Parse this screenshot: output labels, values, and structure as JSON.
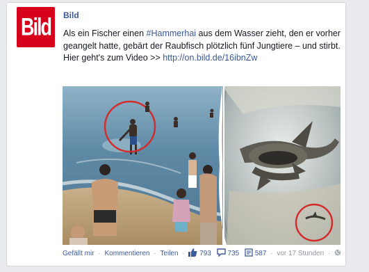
{
  "post": {
    "page_name": "Bild",
    "logo_text": "Bild",
    "text_line_pre": "Als ein Fischer einen ",
    "hashtag": "#Hammerhai",
    "text_line_post": " aus dem Wasser zieht, den er vorher geangelt hatte, gebärt der Raubfisch plötzlich fünf Jungtiere – und stirbt.",
    "video_line_pre": "Hier geht's zum Video >> ",
    "link": "http://on.bild.de/16ibnZw"
  },
  "footer": {
    "like": "Gefällt mir",
    "comment": "Kommentieren",
    "share": "Teilen",
    "likes_count": "793",
    "comments_count": "735",
    "shares_count": "587",
    "timestamp": "vor 17 Stunden"
  },
  "colors": {
    "brand_red": "#d6001c",
    "link_blue": "#3b5998",
    "annotation_red": "#d12d2d"
  },
  "icons": [
    "like-icon",
    "comment-icon",
    "share-icon",
    "globe-icon"
  ]
}
